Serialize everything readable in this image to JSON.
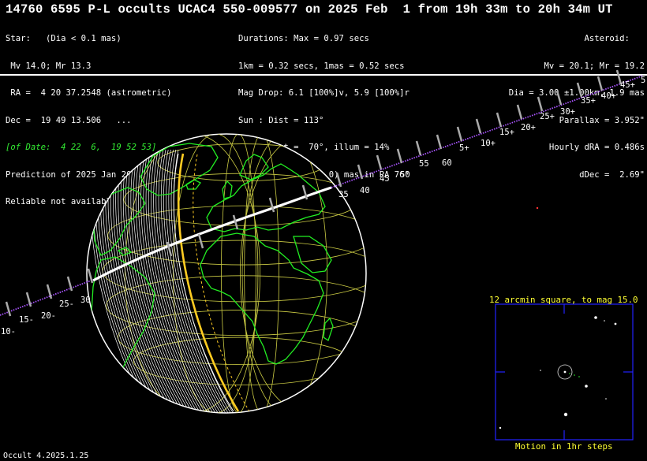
{
  "title": "14760 6595 P-L occults UCAC4 550-009577 on 2025 Feb  1 from 19h 33m to 20h 34m UT",
  "star": {
    "lines": [
      "Star:   (Dia < 0.1 mas)",
      " Mv 14.0; Mr 13.3",
      " RA =  4 20 37.2548 (astrometric)",
      "Dec =  19 49 13.506   ...",
      "[of Date:  4 22  6,  19 52 53]",
      "Prediction of 2025 Jan 20.1",
      "Reliable not available"
    ]
  },
  "event": {
    "lines": [
      "Durations: Max = 0.97 secs",
      "1km = 0.32 secs, 1mas = 0.52 secs",
      "Mag Drop: 6.1 [100%]v, 5.9 [100%]r",
      "Sun : Dist = 113°",
      "Moon: Dist =  70°, illum = 14%",
      "1σ Err: ±(2.0 x 0.0) mas in PA 76°"
    ]
  },
  "asteroid": {
    "lines": [
      "Asteroid:   ",
      "Mv = 20.1; Mr = 19.2",
      "Dia = 3.00 ±1.00km, 1.9 mas",
      "Parallax = 3.952\"",
      "Hourly dRA = 0.486s",
      "dDec =  2.69\""
    ]
  },
  "track": {
    "labels": [
      "10-",
      "15-",
      "20-",
      "25-",
      "30",
      "35",
      "40",
      "45",
      "50",
      "55",
      "60",
      "5+",
      "10+",
      "15+",
      "20+",
      "25+",
      "30+",
      "35+",
      "40+",
      "45+",
      "5"
    ]
  },
  "inset": {
    "title": "12 arcmin square, to mag 15.0",
    "footer": "Motion in 1hr steps"
  },
  "footer": "Occult 4.2025.1.25",
  "colors": {
    "land": "#22ee22",
    "grid": "#cccc44",
    "track_dots": "#aa55ff",
    "shadow_edge": "#ffcc22",
    "inset_border": "#2222ff",
    "inset_text": "#ffff33"
  }
}
